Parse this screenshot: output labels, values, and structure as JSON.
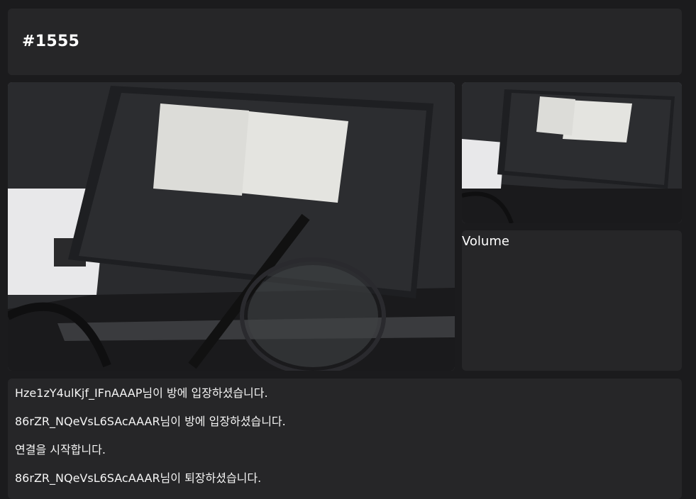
{
  "header": {
    "title": "#1555"
  },
  "videos": {
    "main": {
      "icon": "webcam-feed-main"
    },
    "thumbnail": {
      "icon": "webcam-feed-thumb"
    }
  },
  "side_panel": {
    "volume_label": "Volume"
  },
  "chat_log": [
    "Hze1zY4ulKjf_IFnAAAP님이 방에 입장하셨습니다.",
    "86rZR_NQeVsL6SAcAAAR님이 방에 입장하셨습니다.",
    "연결을 시작합니다.",
    "86rZR_NQeVsL6SAcAAAR님이 퇴장하셨습니다."
  ],
  "colors": {
    "background": "#1b1b1d",
    "panel": "#262628",
    "text": "#ffffff"
  }
}
